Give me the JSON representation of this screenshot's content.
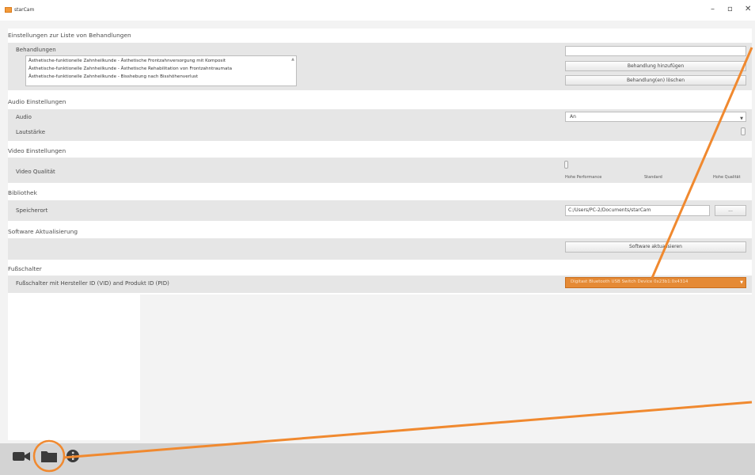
{
  "window": {
    "title": "starCam",
    "minimize": "–",
    "maximize": "▫",
    "close": "✕"
  },
  "sections": {
    "treatments": "Einstellungen zur Liste von Behandlungen",
    "audio": "Audio Einstellungen",
    "video": "Video Einstellungen",
    "library": "Bibliothek",
    "update": "Software Aktualisierung",
    "footswitch": "Fußschalter"
  },
  "treatments": {
    "label": "Behandlungen",
    "items": [
      "Ästhetische-funktionelle Zahnheilkunde - Ästhetische Frontzahnversorgung mit Komposit",
      "Ästhetische-funktionelle Zahnheilkunde - Ästhetische Rehabilitation von Frontzahntraumata",
      "Ästhetische-funktionelle Zahnheilkunde - Bisshebung nach Bisshöhenverlust"
    ],
    "new_value": "",
    "add_label": "Behandlung hinzufügen",
    "delete_label": "Behandlung(en) löschen"
  },
  "audio": {
    "audio_label": "Audio",
    "audio_value": "An",
    "volume_label": "Lautstärke"
  },
  "video": {
    "quality_label": "Video Qualität",
    "ticks": [
      "Hohe Performance",
      "Standard",
      "Hohe Qualität"
    ]
  },
  "library": {
    "location_label": "Speicherort",
    "path": "C:/Users/PC-2/Documents/starCam",
    "browse_label": "..."
  },
  "update": {
    "button_label": "Software aktualisieren"
  },
  "footswitch": {
    "label": "Fußschalter mit Hersteller ID (VID) and Produkt ID (PID)",
    "device": "Digitast Bluetooth USB Switch Device 0x23b1:0x4314"
  },
  "colors": {
    "accent": "#f0892f",
    "device_bg": "#e58a35"
  },
  "icons": [
    "video-camera-icon",
    "folder-icon",
    "info-icon"
  ]
}
